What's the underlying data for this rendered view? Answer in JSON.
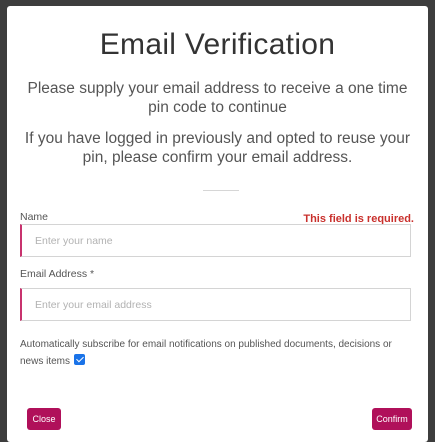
{
  "dialog": {
    "title": "Email Verification",
    "intro": "Please supply your email address to receive a one time pin code to continue",
    "intro_reuse": "If you have logged in previously and opted to reuse your pin, please confirm your email address."
  },
  "form": {
    "name": {
      "label": "Name",
      "placeholder": "Enter your name",
      "value": "",
      "error": "This field is required."
    },
    "email": {
      "label": "Email Address *",
      "placeholder": "Enter your email address",
      "value": ""
    },
    "subscribe": {
      "label": "Automatically subscribe for email notifications on published documents, decisions or news items",
      "checked": true
    }
  },
  "buttons": {
    "close": "Close",
    "confirm": "Confirm"
  },
  "colors": {
    "primary": "#b0105a",
    "error": "#c9302c",
    "input_accent": "#c8326e",
    "checkbox": "#1a73e8"
  }
}
